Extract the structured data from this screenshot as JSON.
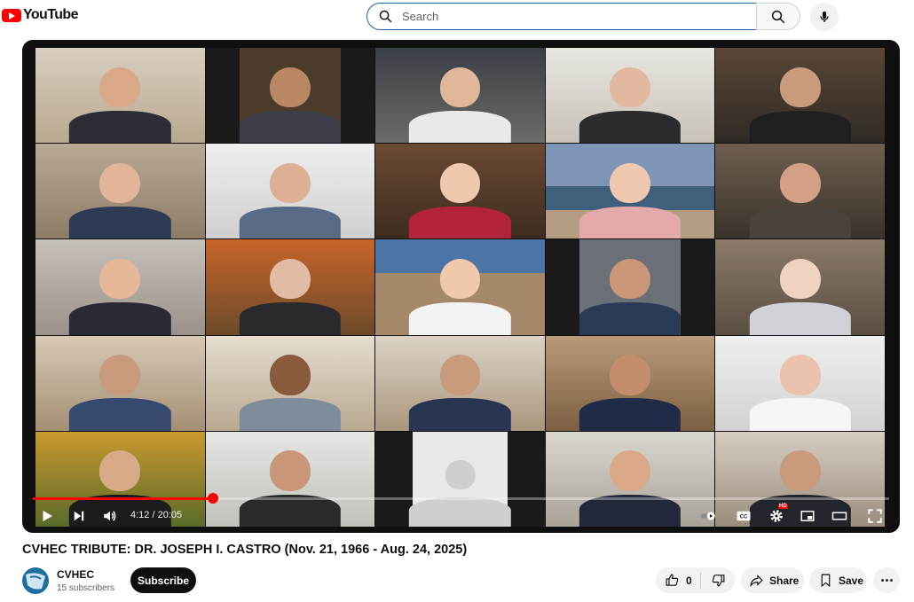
{
  "header": {
    "logo_text": "YouTube",
    "search_placeholder": "Search"
  },
  "player": {
    "time_display": "4:12 / 20:05",
    "progress_fraction": 0.21,
    "quality_badge": "HD"
  },
  "video": {
    "title": "CVHEC TRIBUTE: DR. JOSEPH I. CASTRO (Nov. 21, 1966 - Aug. 24, 2025)"
  },
  "channel": {
    "name": "CVHEC",
    "subscribers": "15 subscribers",
    "subscribe_label": "Subscribe"
  },
  "actions": {
    "like_count": "0",
    "share_label": "Share",
    "save_label": "Save"
  },
  "colors": {
    "brand_red": "#ff0000",
    "search_border": "#1c62b9"
  }
}
